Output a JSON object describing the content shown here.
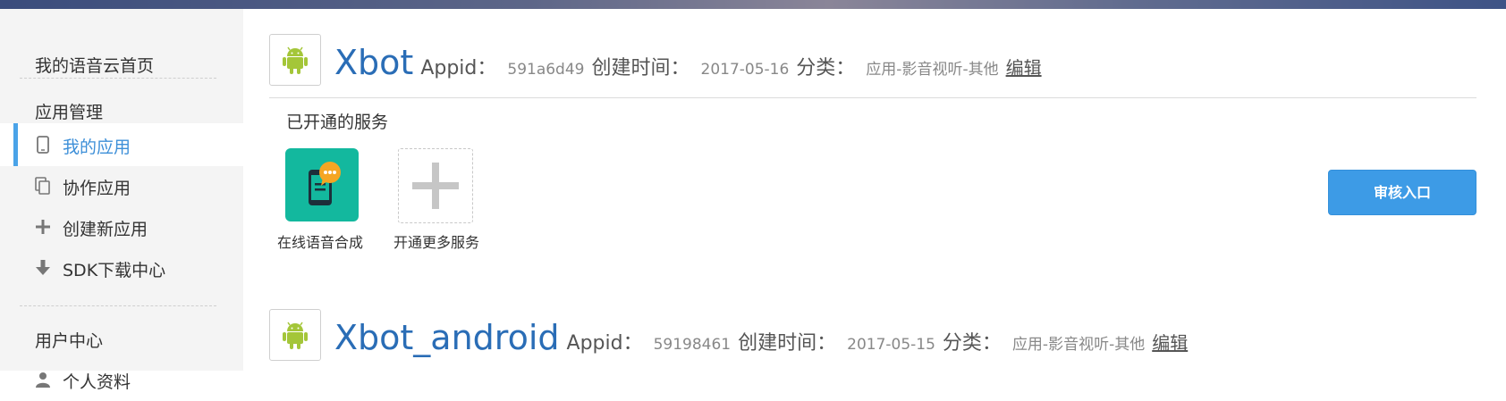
{
  "sidebar": {
    "home": "我的语音云首页",
    "app_management": "应用管理",
    "items": [
      {
        "label": "我的应用",
        "icon": "phone-icon"
      },
      {
        "label": "协作应用",
        "icon": "copy-icon"
      },
      {
        "label": "创建新应用",
        "icon": "plus-icon"
      },
      {
        "label": "SDK下载中心",
        "icon": "download-icon"
      }
    ],
    "user_center": "用户中心",
    "profile": "个人资料"
  },
  "apps": [
    {
      "name": "Xbot",
      "appid_label": "Appid：",
      "appid": "591a6d49",
      "created_label": "创建时间：",
      "created": "2017-05-16",
      "category_label": "分类：",
      "category": "应用-影音视听-其他",
      "edit": "编辑"
    },
    {
      "name": "Xbot_android",
      "appid_label": "Appid：",
      "appid": "59198461",
      "created_label": "创建时间：",
      "created": "2017-05-15",
      "category_label": "分类：",
      "category": "应用-影音视听-其他",
      "edit": "编辑"
    }
  ],
  "services": {
    "heading": "已开通的服务",
    "tts_label": "在线语音合成",
    "more_label": "开通更多服务"
  },
  "audit_button": "审核入口",
  "colors": {
    "accent_blue": "#3d9be6",
    "active_text": "#3d8fd8",
    "android_green": "#a4c639",
    "service_teal": "#13b89e"
  }
}
